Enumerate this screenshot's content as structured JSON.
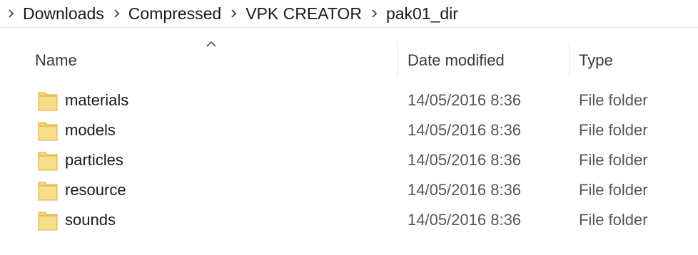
{
  "breadcrumb": {
    "items": [
      "Downloads",
      "Compressed",
      "VPK CREATOR",
      "pak01_dir"
    ]
  },
  "columns": {
    "name": "Name",
    "date": "Date modified",
    "type": "Type",
    "sort_icon": "chevron-up-icon"
  },
  "colors": {
    "folder_fill": "#f5d57a",
    "folder_edge": "#d9ad3c"
  },
  "files": [
    {
      "name": "materials",
      "date": "14/05/2016 8:36",
      "type": "File folder",
      "icon": "folder-icon"
    },
    {
      "name": "models",
      "date": "14/05/2016 8:36",
      "type": "File folder",
      "icon": "folder-icon"
    },
    {
      "name": "particles",
      "date": "14/05/2016 8:36",
      "type": "File folder",
      "icon": "folder-icon"
    },
    {
      "name": "resource",
      "date": "14/05/2016 8:36",
      "type": "File folder",
      "icon": "folder-icon"
    },
    {
      "name": "sounds",
      "date": "14/05/2016 8:36",
      "type": "File folder",
      "icon": "folder-icon"
    }
  ]
}
